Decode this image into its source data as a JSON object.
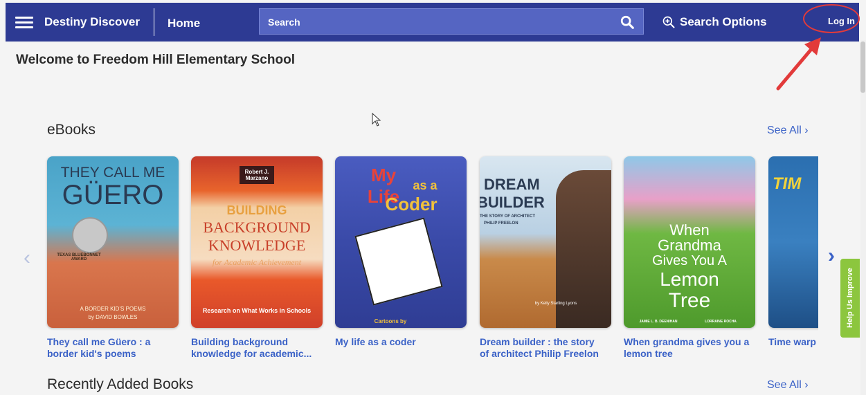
{
  "header": {
    "app_title": "Destiny Discover",
    "home_label": "Home",
    "search_placeholder": "Search",
    "search_options_label": "Search Options",
    "login_label": "Log In"
  },
  "welcome_text": "Welcome to Freedom Hill Elementary School",
  "sections": [
    {
      "title": "eBooks",
      "see_all": "See All ›"
    },
    {
      "title": "Recently Added Books",
      "see_all": "See All ›"
    }
  ],
  "books": [
    {
      "title_line1": "They call me Güero : a",
      "title_line2": "border kid's poems",
      "cover_line1": "THEY CALL ME",
      "cover_line2": "GÜERO",
      "cover_line3": "A BORDER KID'S POEMS",
      "cover_line4": "by DAVID BOWLES",
      "badge": "TEXAS BLUEBONNET AWARD",
      "color": "#4aa3c8"
    },
    {
      "title_line1": "Building background",
      "title_line2": "knowledge for academic...",
      "cover_line1": "Robert J. Marzano",
      "cover_line2": "BUILDING",
      "cover_line3": "BACKGROUND",
      "cover_line4": "KNOWLEDGE",
      "cover_line5": "for Academic Achievement",
      "cover_line6": "Research on What Works in Schools",
      "color": "#e0552a"
    },
    {
      "title_line1": "My life as a coder",
      "title_line2": "",
      "cover_line1": "My Life",
      "cover_line2": "as a",
      "cover_line3": "Coder",
      "cover_line4": "Cartoons by",
      "color": "#3d4fb0"
    },
    {
      "title_line1": "Dream builder : the story",
      "title_line2": "of architect Philip Freelon",
      "cover_line1": "DREAM",
      "cover_line2": "BUILDER",
      "cover_line3": "THE STORY OF ARCHITECT",
      "cover_line4": "PHILIP FREELON",
      "cover_line5": "by Kelly Starling Lyons",
      "color": "#b9d0e3"
    },
    {
      "title_line1": "When grandma gives you a",
      "title_line2": "lemon tree",
      "cover_line1": "When",
      "cover_line2": "Grandma",
      "cover_line3": "Gives You A",
      "cover_line4": "Lemon",
      "cover_line5": "Tree",
      "cover_line6": "JAMIE L. B. DEENIHAN",
      "cover_line7": "LORRAINE ROCHA",
      "color": "#5fae3a"
    },
    {
      "title_line1": "Time warp",
      "title_line2": "",
      "cover_line1": "TIM",
      "color": "#2b6fb0"
    }
  ],
  "help_tab": "Help Us Improve"
}
